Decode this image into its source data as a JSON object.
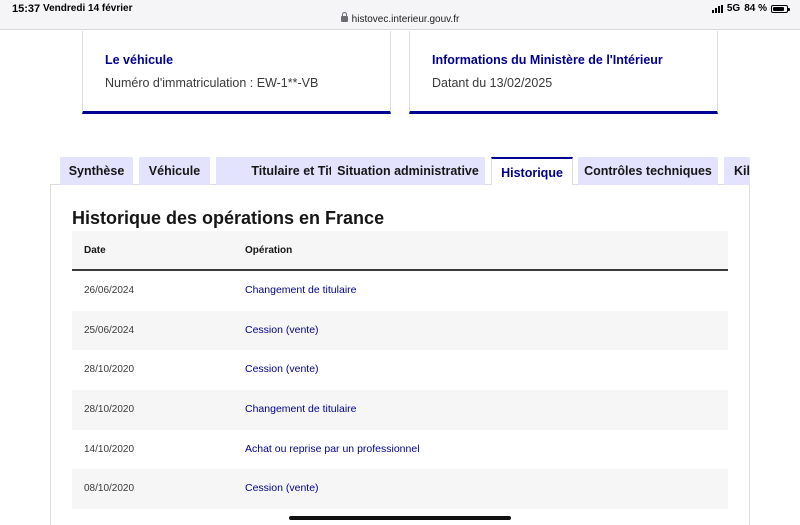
{
  "status_bar": {
    "time": "15:37",
    "date": "Vendredi 14 février",
    "url": "histovec.interieur.gouv.fr",
    "network": "5G",
    "battery": "84 %",
    "battery_level": 0.84
  },
  "cards": [
    {
      "title": "Le véhicule",
      "text": "Numéro d'immatriculation : EW-1**-VB"
    },
    {
      "title": "Informations du Ministère de l'Intérieur",
      "text": "Datant du 13/02/2025"
    }
  ],
  "tabs": [
    {
      "label": "Synthèse"
    },
    {
      "label": "Véhicule"
    },
    {
      "label": "Titulaire et Titre"
    },
    {
      "label": "Situation administrative"
    },
    {
      "label": "Historique"
    },
    {
      "label": "Contrôles techniques"
    },
    {
      "label": "Kilo"
    }
  ],
  "active_tab": "Historique",
  "section": {
    "title": "Historique des opérations en France"
  },
  "table": {
    "headers": {
      "date": "Date",
      "operation": "Opération"
    },
    "rows": [
      {
        "date": "26/06/2024",
        "operation": "Changement de titulaire"
      },
      {
        "date": "25/06/2024",
        "operation": "Cession (vente)"
      },
      {
        "date": "28/10/2020",
        "operation": "Cession (vente)"
      },
      {
        "date": "28/10/2020",
        "operation": "Changement de titulaire"
      },
      {
        "date": "14/10/2020",
        "operation": "Achat ou reprise par un professionnel"
      },
      {
        "date": "08/10/2020",
        "operation": "Cession (vente)"
      }
    ]
  },
  "colors": {
    "primary": "#000091",
    "tab_background": "#e3e3fd",
    "row_alt": "#f6f6f6"
  }
}
